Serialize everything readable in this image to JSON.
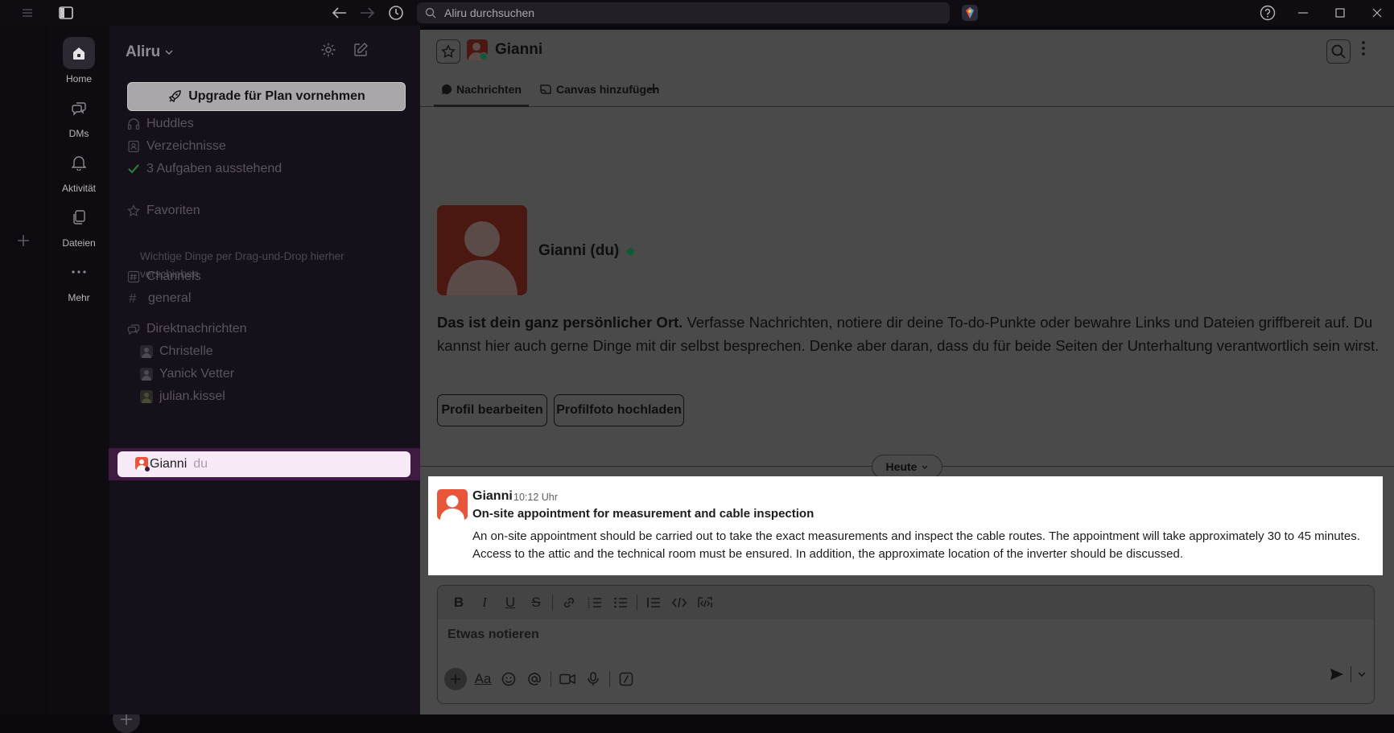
{
  "titlebar": {
    "search_placeholder": "Aliru durchsuchen"
  },
  "rail": {
    "items": [
      {
        "label": "Home",
        "icon": "home-icon"
      },
      {
        "label": "DMs",
        "icon": "dms-icon"
      },
      {
        "label": "Aktivität",
        "icon": "bell-icon"
      },
      {
        "label": "Dateien",
        "icon": "files-icon"
      },
      {
        "label": "Mehr",
        "icon": "more-icon"
      }
    ]
  },
  "sidebar": {
    "workspace": "Aliru",
    "upgrade_label": "Upgrade für Plan vornehmen",
    "nav": [
      "Huddles",
      "Verzeichnisse",
      "3 Aufgaben ausstehend"
    ],
    "favorites_label": "Favoriten",
    "favorites_hint": "Wichtige Dinge per Drag-und-Drop hierher verschieben",
    "channels_label": "Channels",
    "channels": [
      "general"
    ],
    "dms_label": "Direktnachrichten",
    "dms": [
      "Christelle",
      "Yanick Vetter",
      "julian.kissel"
    ],
    "active_dm": {
      "name": "Gianni",
      "suffix": "du"
    }
  },
  "header": {
    "name": "Gianni",
    "tabs": [
      "Nachrichten",
      "Canvas hinzufügen"
    ]
  },
  "intro": {
    "name": "Gianni (du)",
    "text_bold": "Das ist dein ganz persönlicher Ort.",
    "text_rest": " Verfasse Nachrichten, notiere dir deine To-do-Punkte oder bewahre Links und Dateien griffbereit auf. Du kannst hier auch gerne Dinge mit dir selbst besprechen. Denke aber daran, dass du für beide Seiten der Unterhaltung verantwortlich sein wirst.",
    "edit_profile": "Profil bearbeiten",
    "upload_photo": "Profilfoto hochladen"
  },
  "divider_label": "Heute",
  "message": {
    "author": "Gianni",
    "time": "10:12 Uhr",
    "subject": "On-site appointment for measurement and cable inspection",
    "body": "An on-site appointment should be carried out to take the exact measurements and inspect the cable routes. The appointment will take approximately 30 to 45 minutes. Access to the attic and the technical room must be ensured. In addition, the approximate location of the inverter should be discussed."
  },
  "composer": {
    "placeholder": "Etwas notieren",
    "format_label": "Aa"
  },
  "colors": {
    "active_dm_bg": "#f8eaf6",
    "active_dm_border": "#3f1a42",
    "avatar_orange": "#e8553b",
    "presence_green": "#0d5a34"
  }
}
